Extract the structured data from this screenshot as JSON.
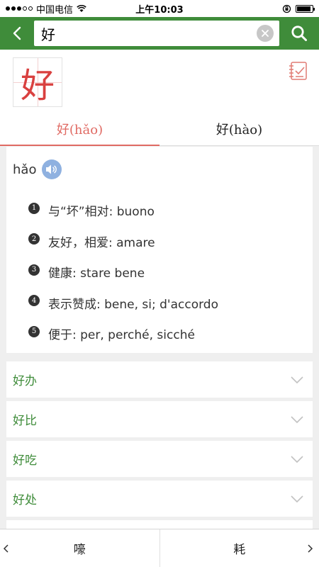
{
  "status_bar": {
    "carrier": "中国电信",
    "time": "上午10:03",
    "signal_bars": 5,
    "signal_filled": 3,
    "battery_level": 0.9
  },
  "header": {
    "search_value": "好",
    "icons": {
      "back": "chevron-left-icon",
      "clear": "clear-icon",
      "search": "search-icon"
    }
  },
  "character": {
    "glyph": "好",
    "note_icon": "notebook-check-icon"
  },
  "tabs": [
    {
      "label": "好(hǎo)",
      "active": true
    },
    {
      "label": "好(hào)",
      "active": false
    }
  ],
  "definition": {
    "pinyin": "hǎo",
    "speaker_icon": "speaker-icon",
    "items": [
      {
        "num": "1",
        "text": "与“坏”相对: buono"
      },
      {
        "num": "2",
        "text": "友好，相爱: amare"
      },
      {
        "num": "3",
        "text": "健康: stare bene"
      },
      {
        "num": "4",
        "text": "表示赞成: bene, si; d'accordo"
      },
      {
        "num": "5",
        "text": "便于: per, perché, sicché"
      }
    ]
  },
  "words": [
    {
      "label": "好办"
    },
    {
      "label": "好比"
    },
    {
      "label": "好吃"
    },
    {
      "label": "好处"
    }
  ],
  "bottom_nav": {
    "prev_label": "嚎",
    "next_label": "耗"
  },
  "colors": {
    "header_green": "#3f8c3a",
    "accent_red": "#e06a63",
    "word_green": "#3f8c3a",
    "speaker_blue": "#8fb1e0"
  }
}
